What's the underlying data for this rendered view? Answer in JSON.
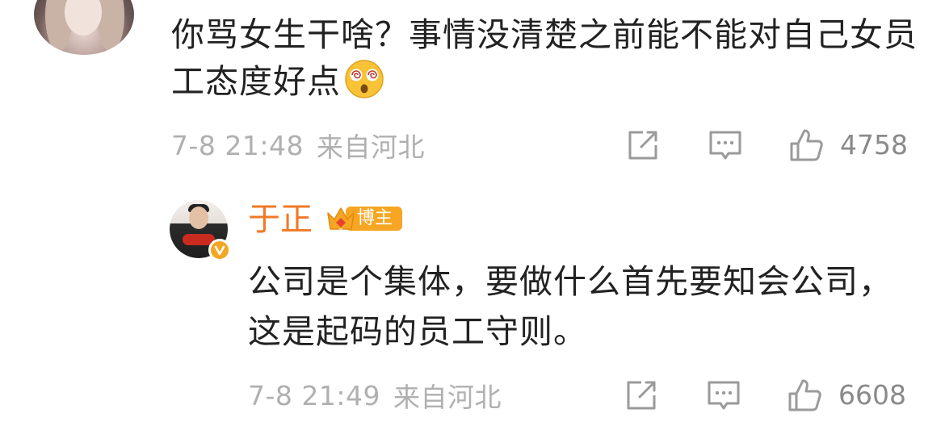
{
  "comment": {
    "text": "你骂女生干啥？事情没清楚之前能不能对自己女员工态度好点",
    "emoji_icon": "dizzy-face-emoji",
    "time": "7-8 21:48",
    "location": "来自河北",
    "likes": "4758"
  },
  "reply": {
    "author": "于正",
    "badge_label": "博主",
    "text": "公司是个集体，要做什么首先要知会公司，这是起码的员工守则。",
    "time": "7-8 21:49",
    "location": "来自河北",
    "likes": "6608"
  },
  "icons": {
    "share": "share-icon",
    "comment": "comment-icon",
    "like": "thumbs-up-icon",
    "verified": "verified-v-icon",
    "crown": "crown-icon"
  },
  "colors": {
    "author_name": "#f07a28",
    "badge": "#f6a623",
    "meta_gray": "#b0b0b0"
  }
}
